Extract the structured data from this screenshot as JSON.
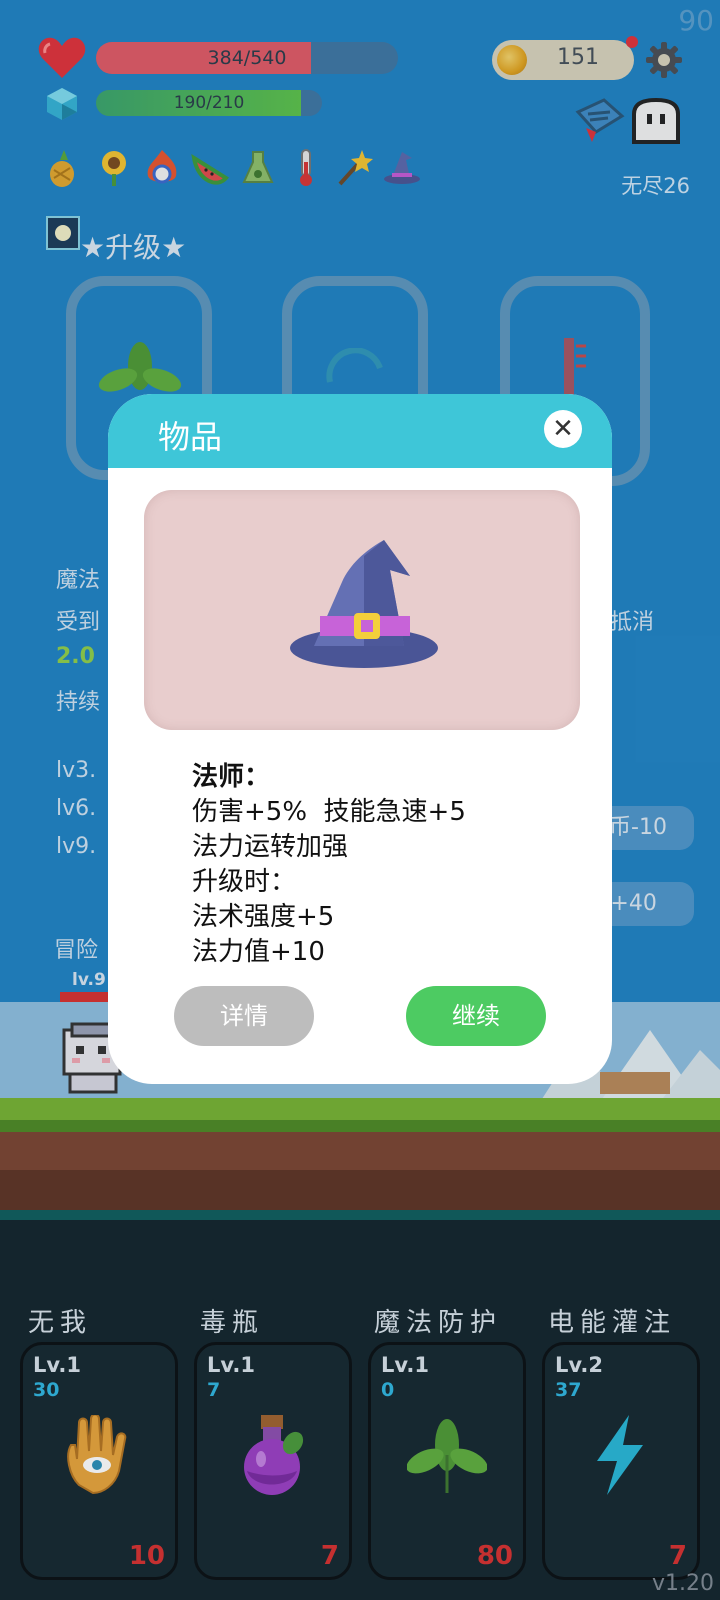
{
  "hud": {
    "fps": "90",
    "hp_text": "384/540",
    "hp_fraction": 0.711,
    "mana_text": "190/210",
    "mana_fraction": 0.905,
    "coins": "151",
    "mode": "无尽26",
    "colors": {
      "hp": "#e04f5f",
      "mana": "#4cb050",
      "accent": "#3ec6d8"
    }
  },
  "items": [
    "pineapple-icon",
    "sunflower-icon",
    "fire-ring-icon",
    "watermelon-icon",
    "flask-icon",
    "thermometer-icon",
    "magic-wand-icon",
    "wizard-hat-icon"
  ],
  "upgrade": {
    "title": "★升级★"
  },
  "background": {
    "line1": "魔法",
    "line2_left": "受到",
    "line2_right": "抵消",
    "line3": "2.0",
    "line4": "持续",
    "lv3": "lv3.",
    "lv6": "lv6.",
    "lv9": "lv9.",
    "adventure": "冒险",
    "hero_lv": "lv.9",
    "btn1": "金币-10",
    "btn2": "P+40"
  },
  "dialog": {
    "title": "物品",
    "close": "✕",
    "item_heading": "法师：",
    "lines": [
      "伤害+5%  技能急速+5",
      "法力运转加强",
      "升级时：",
      "法术强度+5",
      "法力值+10"
    ],
    "detail_button": "详情",
    "continue_button": "继续"
  },
  "skills": [
    {
      "name": "无我",
      "level": "Lv.1",
      "count": "30",
      "cost": "10",
      "icon": "eye-hand-icon"
    },
    {
      "name": "毒瓶",
      "level": "Lv.1",
      "count": "7",
      "cost": "7",
      "icon": "poison-bottle-icon"
    },
    {
      "name": "魔法防护",
      "level": "Lv.1",
      "count": "0",
      "cost": "80",
      "icon": "leaf-icon"
    },
    {
      "name": "电能灌注",
      "level": "Lv.2",
      "count": "37",
      "cost": "7",
      "icon": "lightning-icon"
    }
  ],
  "version": "v1.20"
}
